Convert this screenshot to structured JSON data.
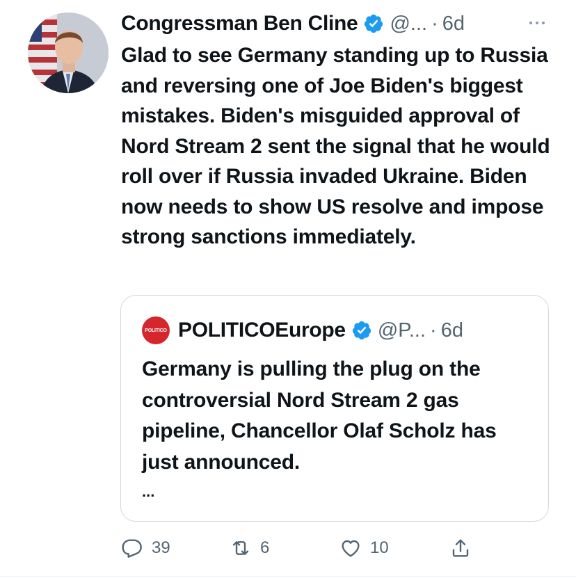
{
  "author": {
    "name": "Congressman Ben Cline",
    "handle": "@...",
    "time": "6d",
    "separator": "·"
  },
  "tweet_text": "Glad to see Germany standing up to Russia and reversing one of Joe Biden's biggest mistakes. Biden's misguided approval of Nord Stream 2 sent the signal that he would roll over if Russia invaded Ukraine. Biden now needs to show US resolve and impose strong sanctions immediately.",
  "quoted": {
    "logo_text": "POLITICO",
    "name": "POLITICOEurope",
    "handle": "@P...",
    "time": "6d",
    "separator": "·",
    "text": "Germany is pulling the plug on the controversial Nord Stream 2 gas pipeline, Chancellor Olaf Scholz has just announced.",
    "ellipsis": "..."
  },
  "actions": {
    "replies": "39",
    "retweets": "6",
    "likes": "10"
  },
  "icons": [
    "more-icon",
    "verified-icon",
    "reply-icon",
    "retweet-icon",
    "like-icon",
    "share-icon"
  ],
  "colors": {
    "verified": "#1d9bf0",
    "secondary_text": "#536471",
    "politico_red": "#d5262d"
  }
}
